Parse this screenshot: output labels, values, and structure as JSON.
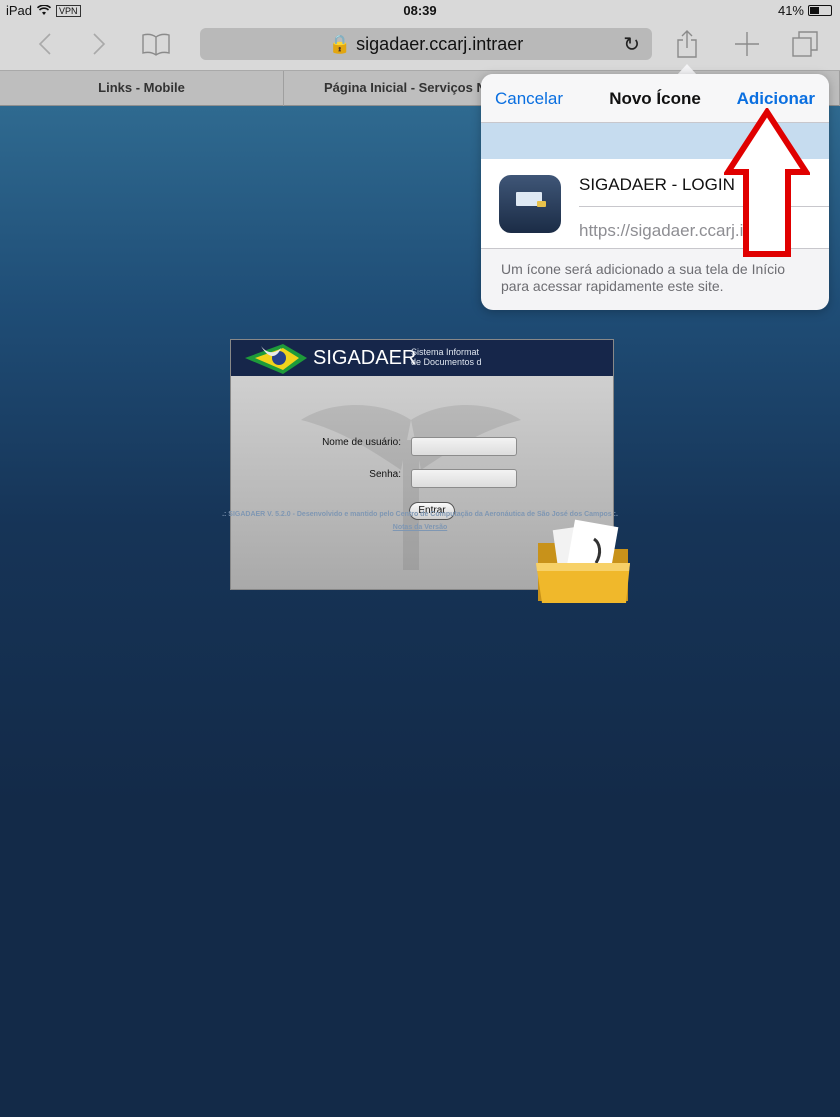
{
  "status_bar": {
    "device": "iPad",
    "vpn": "VPN",
    "time": "08:39",
    "battery": "41%"
  },
  "toolbar": {
    "back_icon": "chevron-left-icon",
    "forward_icon": "chevron-right-icon",
    "bookmarks_icon": "book-icon",
    "url": "sigadaer.ccarj.intraer",
    "share_icon": "share-icon",
    "new_tab_icon": "plus-icon",
    "tabs_icon": "tabs-icon"
  },
  "tabs": [
    {
      "label": "Links - Mobile"
    },
    {
      "label": "Página Inicial - Serviços N"
    }
  ],
  "login": {
    "title": "SIGADAER",
    "subtitle_line1": "Sistema Informat",
    "subtitle_line2": "de Documentos d",
    "username_label": "Nome de usuário:",
    "password_label": "Senha:",
    "submit_label": "Entrar"
  },
  "footer": {
    "credits": ".: SIGADAER V. 5.2.0 - Desenvolvido e mantido pelo Centro de Computação da Aeronáutica de São José dos Campos :.",
    "release_notes_link": "Notas da Versão"
  },
  "popover": {
    "cancel_label": "Cancelar",
    "title": "Novo Ícone",
    "add_label": "Adicionar",
    "name_value": "SIGADAER - LOGIN",
    "url_value": "https://sigadaer.ccarj.intraer",
    "note": "Um ícone será adicionado a sua tela de Início para acessar rapidamente este site."
  },
  "colors": {
    "accent": "#0a6fe0",
    "annotation": "#e00000"
  }
}
